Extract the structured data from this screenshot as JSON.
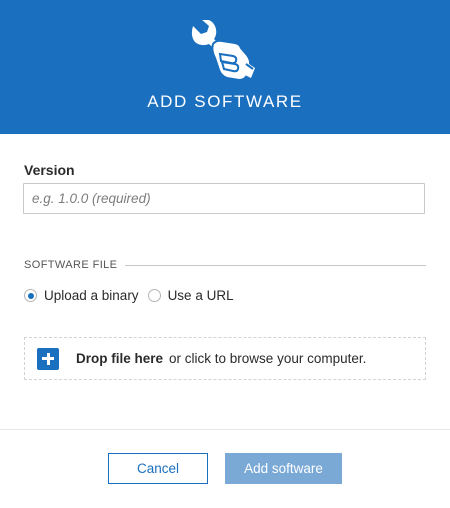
{
  "header": {
    "title": "ADD SOFTWARE",
    "icon": "wrench-hand-icon",
    "background_color": "#1a6fbf"
  },
  "version": {
    "label": "Version",
    "value": "",
    "placeholder": "e.g. 1.0.0 (required)"
  },
  "software_file": {
    "section_label": "SOFTWARE FILE",
    "options": [
      {
        "label": "Upload a binary",
        "selected": true
      },
      {
        "label": "Use a URL",
        "selected": false
      }
    ]
  },
  "dropzone": {
    "icon": "plus-icon",
    "strong_text": "Drop file here",
    "text": "or click to browse your computer."
  },
  "footer": {
    "cancel_label": "Cancel",
    "submit_label": "Add software"
  },
  "colors": {
    "accent": "#1a6fbf",
    "submit_disabled": "#7aa9d6"
  }
}
